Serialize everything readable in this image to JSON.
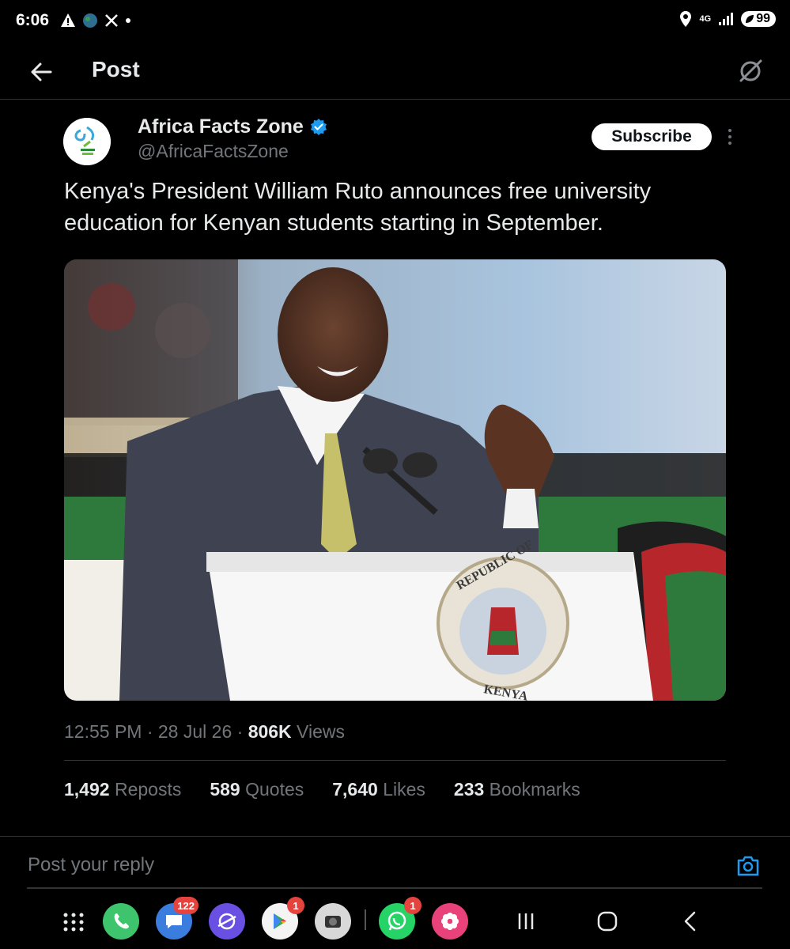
{
  "status_bar": {
    "time": "6:06",
    "network": "4G",
    "battery": "99"
  },
  "header": {
    "title": "Post"
  },
  "post": {
    "author_name": "Africa Facts Zone",
    "handle": "@AfricaFactsZone",
    "subscribe_label": "Subscribe",
    "text": "Kenya's President William Ruto announces free university education for Kenyan students starting in September.",
    "image_podium_text_top": "REPUBLIC OF",
    "image_podium_text_bottom": "KENYA",
    "meta_time": "12:55 PM · 28 Jul 26 · ",
    "meta_views_count": "806K",
    "meta_views_label": " Views",
    "stats": {
      "reposts_count": "1,492",
      "reposts_label": "Reposts",
      "quotes_count": "589",
      "quotes_label": "Quotes",
      "likes_count": "7,640",
      "likes_label": "Likes",
      "bookmarks_count": "233",
      "bookmarks_label": "Bookmarks"
    }
  },
  "reply": {
    "placeholder": "Post your reply"
  },
  "dock": {
    "messages_badge": "122",
    "play_badge": "1",
    "whatsapp_badge": "1"
  },
  "colors": {
    "background": "#000000",
    "text_primary": "#e7e9ea",
    "text_secondary": "#71767b",
    "accent_blue": "#1d9bf0",
    "divider": "#2f3336"
  }
}
